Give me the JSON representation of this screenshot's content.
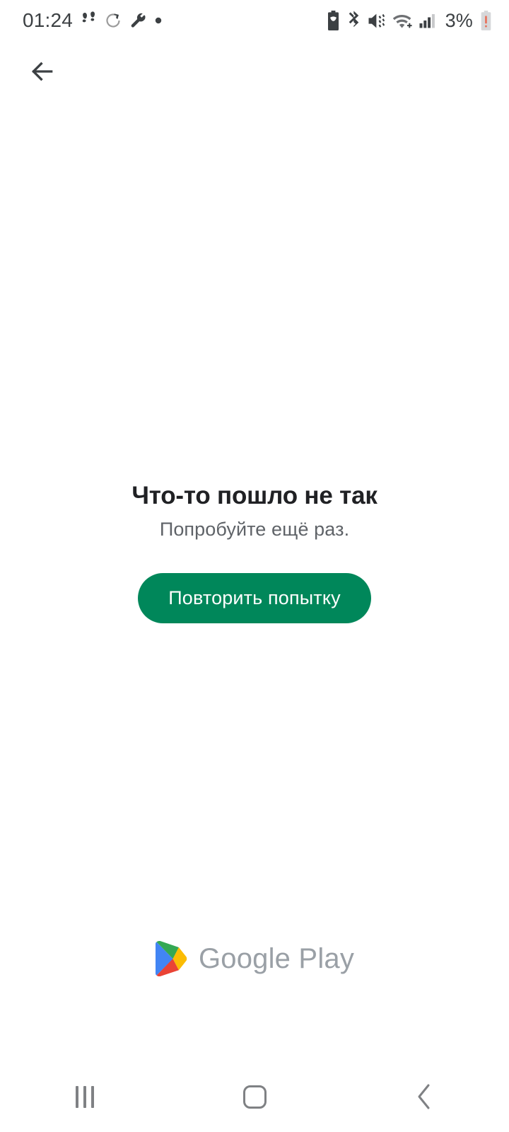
{
  "status_bar": {
    "time": "01:24",
    "battery_percent": "3%",
    "left_icons": [
      {
        "name": "footsteps-icon",
        "label": "Шагомер"
      },
      {
        "name": "sync-refresh-icon",
        "label": "Синхронизация"
      },
      {
        "name": "wrench-icon",
        "label": "Инструменты разработчика"
      },
      {
        "name": "dot-indicator-icon",
        "label": "Уведомление"
      }
    ],
    "right_icons": [
      {
        "name": "battery-saver-icon",
        "label": "Энергосбережение"
      },
      {
        "name": "bluetooth-icon",
        "label": "Bluetooth"
      },
      {
        "name": "volume-vibrate-icon",
        "label": "Вибрация"
      },
      {
        "name": "wifi-icon",
        "label": "Wi-Fi"
      },
      {
        "name": "cellular-signal-icon",
        "label": "Сигнал сети"
      },
      {
        "name": "battery-low-icon",
        "label": "Низкий заряд"
      }
    ]
  },
  "app_bar": {
    "back_label": "Назад"
  },
  "error": {
    "title": "Что-то пошло не так",
    "subtitle": "Попробуйте ещё раз.",
    "retry_label": "Повторить попытку"
  },
  "brand": {
    "text": "Google Play",
    "mark_name": "google-play-logo"
  },
  "nav_bar": {
    "recents_label": "Недавние",
    "home_label": "Главный экран",
    "back_label": "Назад"
  },
  "colors": {
    "accent_green": "#00875A",
    "title": "#202124",
    "subtitle": "#5f6368",
    "brand_gray": "#9aa0a6",
    "nav_gray": "#7f8184",
    "background": "#ffffff",
    "logo_blue": "#4285F4",
    "logo_green": "#34A853",
    "logo_yellow": "#FBBC04",
    "logo_red": "#EA4335",
    "battery_low": "#E8705A"
  }
}
